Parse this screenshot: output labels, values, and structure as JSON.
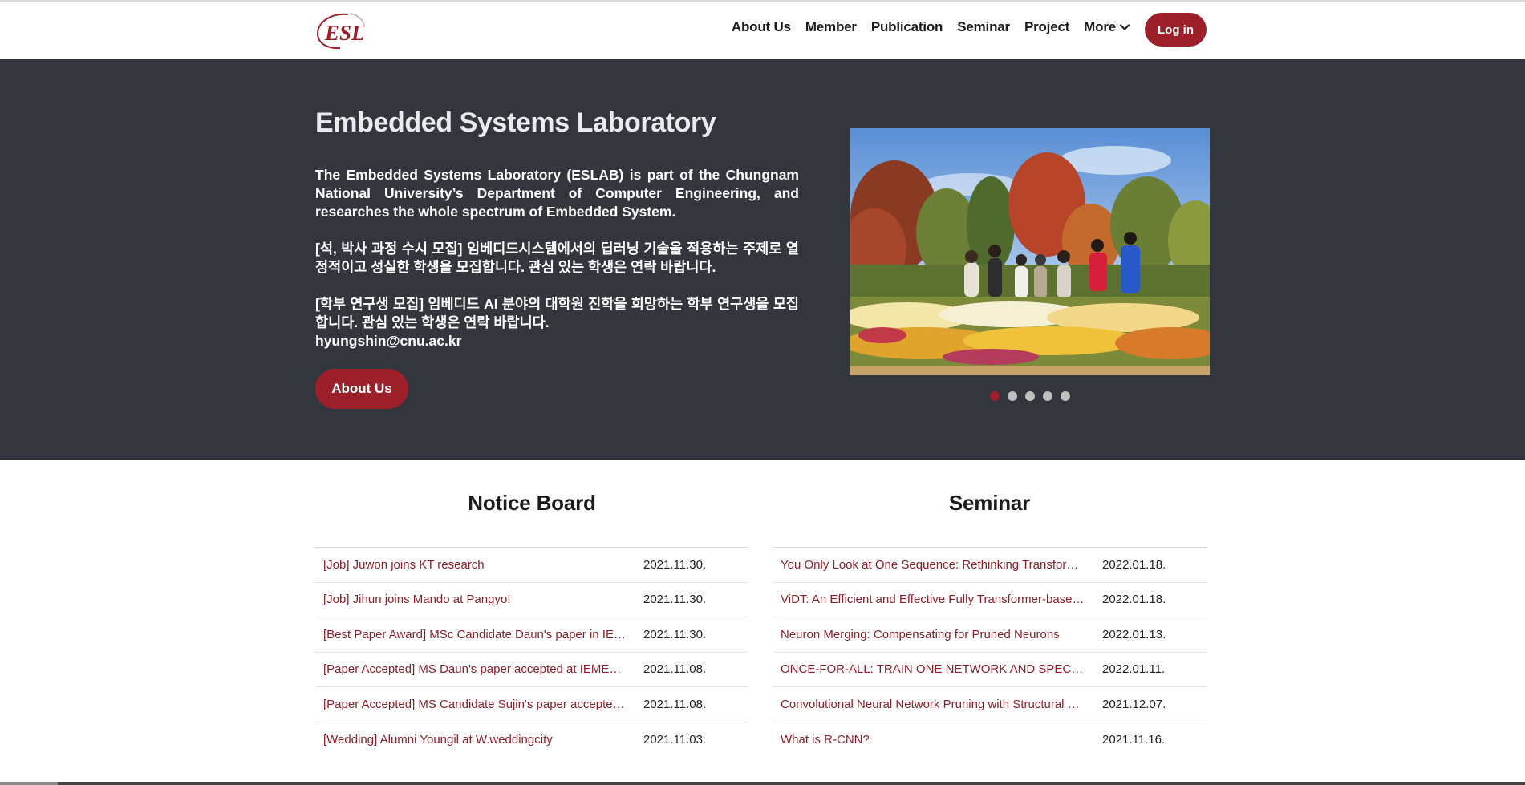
{
  "nav": {
    "logo_text": "ESL",
    "links": [
      "About Us",
      "Member",
      "Publication",
      "Seminar",
      "Project"
    ],
    "more_label": "More",
    "login_label": "Log in"
  },
  "hero": {
    "title": "Embedded Systems Laboratory",
    "paragraph_1": "The Embedded Systems Laboratory (ESLAB) is part of the Chungnam National University’s Department of Computer Engineering, and researches the whole spectrum of Embedded System.",
    "paragraph_2": "[석, 박사 과정 수시 모집] 임베디드시스템에서의 딥러닝 기술을 적용하는 주제로 열정적이고 성실한 학생을 모집합니다. 관심 있는 학생은 연락 바랍니다.",
    "paragraph_3": "[학부 연구생 모집] 임베디드 AI 분야의 대학원 진학을 희망하는 학부 연구생을 모집합니다. 관심 있는 학생은 연락 바랍니다.",
    "email": "hyungshin@cnu.ac.kr",
    "about_button": "About Us",
    "carousel_active": 1,
    "carousel_count": 5
  },
  "notice": {
    "title": "Notice Board",
    "items": [
      {
        "title": "[Job] Juwon joins KT research",
        "date": "2021.11.30."
      },
      {
        "title": "[Job] Jihun joins Mando at Pangyo!",
        "date": "2021.11.30."
      },
      {
        "title": "[Best Paper Award] MSc Candidate Daun's paper in IEMEK Fall Conference",
        "date": "2021.11.30."
      },
      {
        "title": "[Paper Accepted] MS Daun's paper accepted at IEMEK Fall Conference",
        "date": "2021.11.08."
      },
      {
        "title": "[Paper Accepted] MS Candidate Sujin's paper accepted at conference",
        "date": "2021.11.08."
      },
      {
        "title": "[Wedding] Alumni Youngil at W.weddingcity",
        "date": "2021.11.03."
      }
    ]
  },
  "seminar": {
    "title": "Seminar",
    "items": [
      {
        "title": "You Only Look at One Sequence: Rethinking Transformer in Vision",
        "date": "2022.01.18."
      },
      {
        "title": "ViDT: An Efficient and Effective Fully Transformer-based Object Detector",
        "date": "2022.01.18."
      },
      {
        "title": "Neuron Merging: Compensating for Pruned Neurons",
        "date": "2022.01.13."
      },
      {
        "title": "ONCE-FOR-ALL: TRAIN ONE NETWORK AND SPECIALIZE IT FOR EFFICIENT DEPLOYMENT",
        "date": "2022.01.11."
      },
      {
        "title": "Convolutional Neural Network Pruning with Structural Redundancy Reduction",
        "date": "2021.12.07."
      },
      {
        "title": "What is R-CNN?",
        "date": "2021.11.16."
      }
    ]
  },
  "colors": {
    "accent": "#9c1f2a",
    "hero_bg": "#33373d"
  }
}
